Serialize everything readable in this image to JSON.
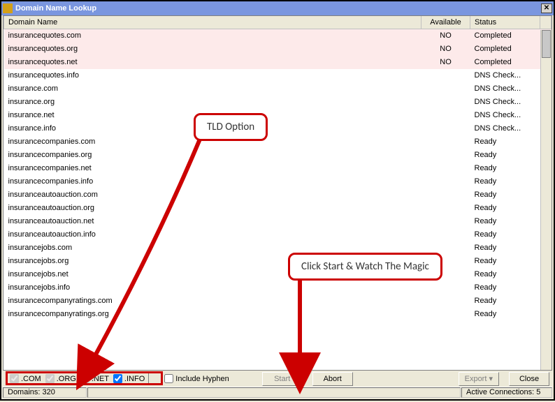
{
  "window": {
    "title": "Domain Name Lookup"
  },
  "columns": {
    "domain": "Domain Name",
    "available": "Available",
    "status": "Status"
  },
  "rows": [
    {
      "domain": "insurancequotes.com",
      "available": "NO",
      "status": "Completed",
      "pink": true
    },
    {
      "domain": "insurancequotes.org",
      "available": "NO",
      "status": "Completed",
      "pink": true
    },
    {
      "domain": "insurancequotes.net",
      "available": "NO",
      "status": "Completed",
      "pink": true
    },
    {
      "domain": "insurancequotes.info",
      "available": "",
      "status": "DNS Check..."
    },
    {
      "domain": "insurance.com",
      "available": "",
      "status": "DNS Check..."
    },
    {
      "domain": "insurance.org",
      "available": "",
      "status": "DNS Check..."
    },
    {
      "domain": "insurance.net",
      "available": "",
      "status": "DNS Check..."
    },
    {
      "domain": "insurance.info",
      "available": "",
      "status": "DNS Check..."
    },
    {
      "domain": "insurancecompanies.com",
      "available": "",
      "status": "Ready"
    },
    {
      "domain": "insurancecompanies.org",
      "available": "",
      "status": "Ready"
    },
    {
      "domain": "insurancecompanies.net",
      "available": "",
      "status": "Ready"
    },
    {
      "domain": "insurancecompanies.info",
      "available": "",
      "status": "Ready"
    },
    {
      "domain": "insuranceautoauction.com",
      "available": "",
      "status": "Ready"
    },
    {
      "domain": "insuranceautoauction.org",
      "available": "",
      "status": "Ready"
    },
    {
      "domain": "insuranceautoauction.net",
      "available": "",
      "status": "Ready"
    },
    {
      "domain": "insuranceautoauction.info",
      "available": "",
      "status": "Ready"
    },
    {
      "domain": "insurancejobs.com",
      "available": "",
      "status": "Ready"
    },
    {
      "domain": "insurancejobs.org",
      "available": "",
      "status": "Ready"
    },
    {
      "domain": "insurancejobs.net",
      "available": "",
      "status": "Ready"
    },
    {
      "domain": "insurancejobs.info",
      "available": "",
      "status": "Ready"
    },
    {
      "domain": "insurancecompanyratings.com",
      "available": "",
      "status": "Ready"
    },
    {
      "domain": "insurancecompanyratings.org",
      "available": "",
      "status": "Ready"
    }
  ],
  "tlds": {
    "com": ".COM",
    "org": ".ORG",
    "net": ".NET",
    "info": ".INFO"
  },
  "hyphen_label": "Include Hyphen",
  "buttons": {
    "start": "Start",
    "abort": "Abort",
    "export": "Export",
    "close": "Close"
  },
  "status": {
    "domains_label": "Domains:",
    "domains_count": "320",
    "conn_label": "Active Connections:",
    "conn_count": "5"
  },
  "annotations": {
    "tld": "TLD Option",
    "start": "Click Start & Watch The Magic"
  }
}
